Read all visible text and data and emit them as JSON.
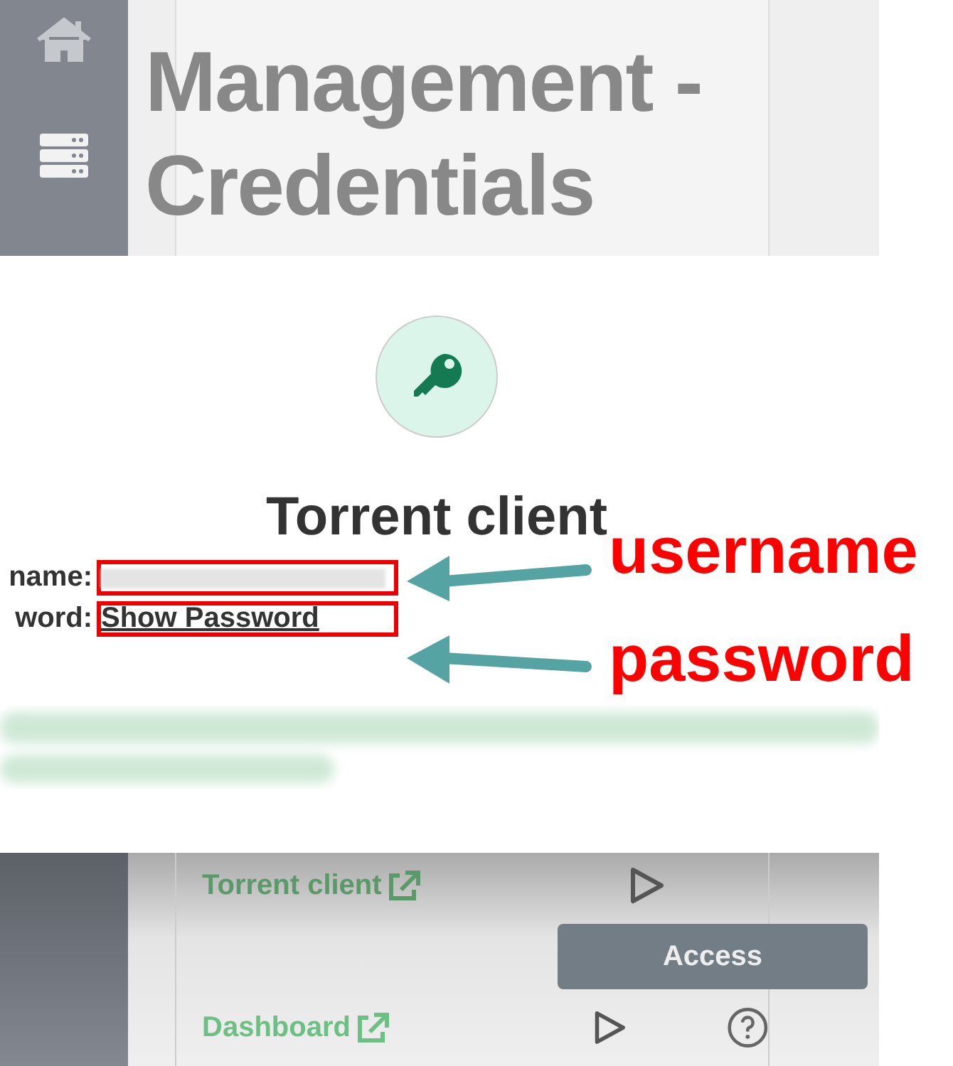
{
  "header": {
    "title_lines": [
      "Management -",
      "Credentials"
    ]
  },
  "modal": {
    "title": "Torrent client",
    "fields": [
      {
        "label": "name:",
        "kind": "blurred"
      },
      {
        "label": "word:",
        "kind": "link",
        "value": "Show Password"
      }
    ]
  },
  "annotations": [
    {
      "text": "username"
    },
    {
      "text": "password"
    }
  ],
  "services": [
    {
      "name": "Torrent client",
      "help": false
    },
    {
      "name": "Dashboard",
      "help": true
    }
  ],
  "tooltip": {
    "text": "Access"
  }
}
